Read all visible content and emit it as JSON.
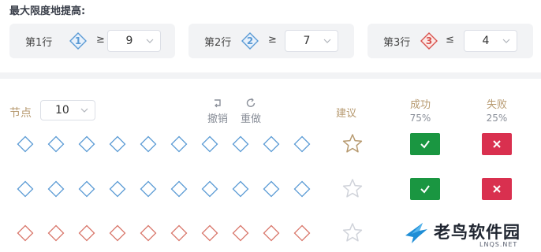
{
  "title": "最大限度地提高:",
  "criteria": [
    {
      "label": "第1行",
      "badge": "1",
      "operator": "≥",
      "value": "9",
      "color": "#5b9bd5"
    },
    {
      "label": "第2行",
      "badge": "2",
      "operator": "≥",
      "value": "7",
      "color": "#5b9bd5"
    },
    {
      "label": "第3行",
      "badge": "3",
      "operator": "≤",
      "value": "4",
      "color": "#d9534f"
    }
  ],
  "controls": {
    "nodes_label": "节点",
    "nodes_value": "10",
    "undo_label": "撤销",
    "redo_label": "重做"
  },
  "columns": {
    "suggest": "建议",
    "success": "成功",
    "success_pct": "75%",
    "fail": "失败",
    "fail_pct": "25%"
  },
  "rows": [
    {
      "color": "#5b9bd5",
      "star": "filled-outline",
      "buttons": true
    },
    {
      "color": "#5b9bd5",
      "star": "empty",
      "buttons": true
    },
    {
      "color": "#d9776b",
      "star": "empty",
      "buttons": false
    }
  ],
  "colors": {
    "blue_diamond": "#5b9bd5",
    "red_diamond": "#d9776b",
    "star_active": "#b79a70",
    "star_inactive": "#d0d3da",
    "success": "#1a9641",
    "fail": "#d9304f",
    "label_gold": "#b79a70"
  },
  "icons": {
    "check": "check-icon",
    "cross": "close-icon",
    "undo": "undo-icon",
    "redo": "redo-icon",
    "chevron": "chevron-down-icon"
  },
  "watermark": {
    "text": "老鸟软件园",
    "sub": "LNQS.NET"
  }
}
